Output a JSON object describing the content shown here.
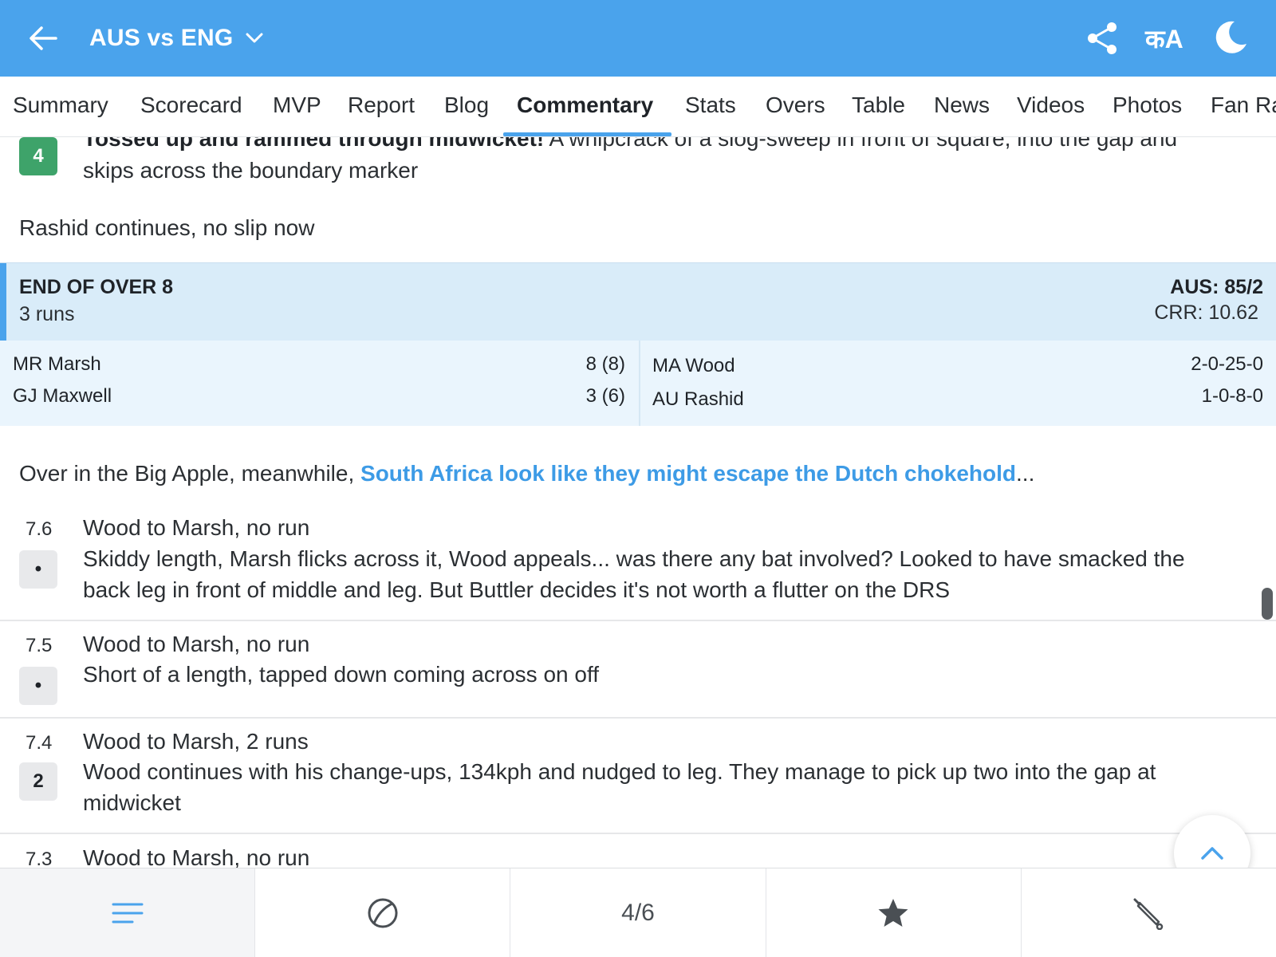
{
  "header": {
    "title": "AUS vs ENG",
    "lang_label": "कA",
    "colors": {
      "bar": "#4aa3ec"
    },
    "icons": [
      "back-arrow-icon",
      "chevron-down-icon",
      "share-icon",
      "language-icon",
      "moon-icon"
    ]
  },
  "tabs": [
    {
      "label": "Summary"
    },
    {
      "label": "Scorecard"
    },
    {
      "label": "MVP"
    },
    {
      "label": "Report"
    },
    {
      "label": "Blog"
    },
    {
      "label": "Commentary"
    },
    {
      "label": "Stats"
    },
    {
      "label": "Overs"
    },
    {
      "label": "Table"
    },
    {
      "label": "News"
    },
    {
      "label": "Videos"
    },
    {
      "label": "Photos"
    },
    {
      "label": "Fan Ra"
    }
  ],
  "active_tab": "Commentary",
  "feed": {
    "top_ball": {
      "badge": "4",
      "bold_text": "Tossed up and rammed through midwicket!",
      "text": " A whipcrack of a slog-sweep in front of square, into the gap and",
      "text2": "skips across the boundary marker"
    },
    "note1": "Rashid continues, no slip now",
    "end_of_over": {
      "title": "END OF OVER 8",
      "runs": "3 runs",
      "score": "AUS: 85/2",
      "crr": "CRR: 10.62"
    },
    "batters": [
      {
        "name": "MR Marsh",
        "stat": "8 (8)"
      },
      {
        "name": "GJ Maxwell",
        "stat": "3 (6)"
      }
    ],
    "bowlers": [
      {
        "name": "MA Wood",
        "stat": "2-0-25-0"
      },
      {
        "name": "AU Rashid",
        "stat": "1-0-8-0"
      }
    ],
    "note2": {
      "prefix": "Over in the Big Apple, meanwhile, ",
      "link": "South Africa look like they might escape the Dutch chokehold",
      "suffix": "..."
    },
    "balls": [
      {
        "over": "7.6",
        "badge": "•",
        "headline": "Wood to Marsh, no run",
        "line1": "Skiddy length, Marsh flicks across it, Wood appeals... was there any bat involved? Looked to have smacked the",
        "line2": "back leg in front of middle and leg. But Buttler decides it's not worth a flutter on the DRS"
      },
      {
        "over": "7.5",
        "badge": "•",
        "headline": "Wood to Marsh, no run",
        "line1": "Short of a length, tapped down coming across on off",
        "line2": ""
      },
      {
        "over": "7.4",
        "badge": "2",
        "headline": "Wood to Marsh, 2 runs",
        "line1": "Wood continues with his change-ups, 134kph and nudged to leg. They manage to pick up two into the gap at",
        "line2": "midwicket"
      },
      {
        "over": "7.3",
        "badge": "",
        "headline": "Wood to Marsh, no run",
        "line1": "",
        "line2": ""
      }
    ]
  },
  "bottom_nav": {
    "page_indicator": "4/6",
    "icons": [
      "menu-lines-icon",
      "ball-icon",
      "star-icon",
      "cricket-bat-icon"
    ]
  }
}
